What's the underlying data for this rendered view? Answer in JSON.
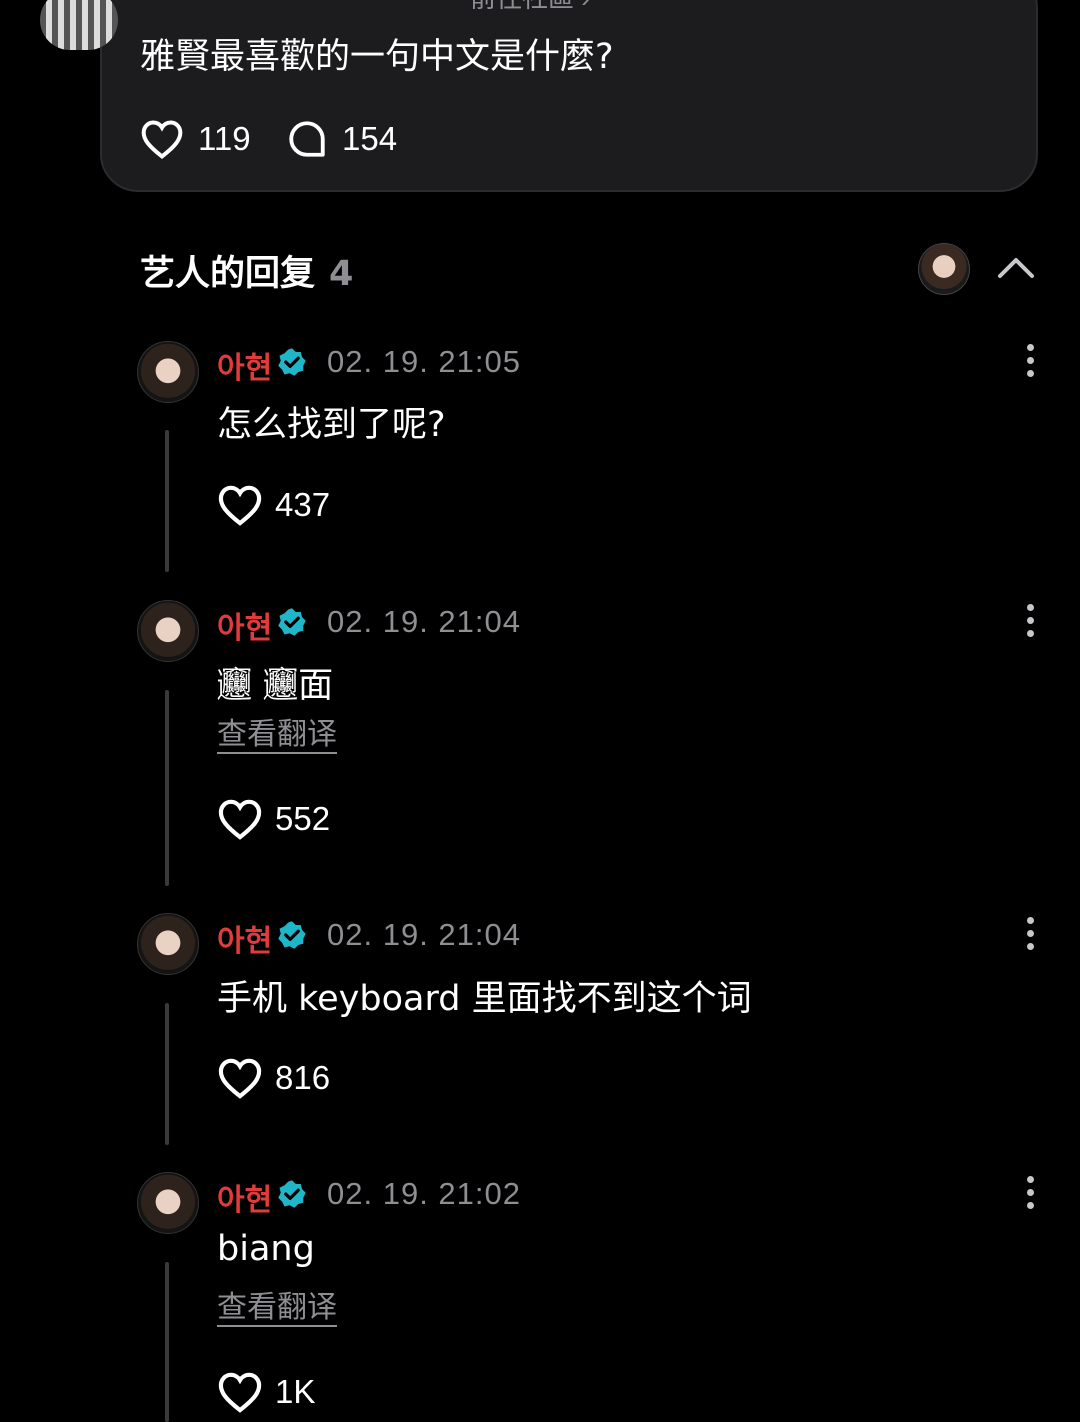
{
  "post": {
    "partial_link": "前往社區 ›",
    "question": "雅賢最喜歡的一句中文是什麼?",
    "likes": "119",
    "comments": "154"
  },
  "section": {
    "title": "艺人的回复",
    "count": "4"
  },
  "replies": [
    {
      "name": "아현",
      "time": "02. 19. 21:05",
      "text": "怎么找到了呢?",
      "translate": "",
      "likes": "437"
    },
    {
      "name": "아현",
      "time": "02. 19. 21:04",
      "text": "𰻞 𰻞面",
      "translate": "查看翻译",
      "likes": "552"
    },
    {
      "name": "아현",
      "time": "02. 19. 21:04",
      "text": "手机 keyboard 里面找不到这个词",
      "translate": "",
      "likes": "816"
    },
    {
      "name": "아현",
      "time": "02. 19. 21:02",
      "text": " biang",
      "translate": "查看翻译",
      "likes": "1K"
    }
  ],
  "colors": {
    "background": "#000000",
    "card": "#1c1c1e",
    "name_red": "#e23b3b",
    "verified_cyan": "#1fb6c9",
    "muted": "#8e8e93"
  },
  "icons": [
    "heart-icon",
    "comment-icon",
    "verified-icon",
    "more-icon",
    "chevron-up-icon"
  ]
}
